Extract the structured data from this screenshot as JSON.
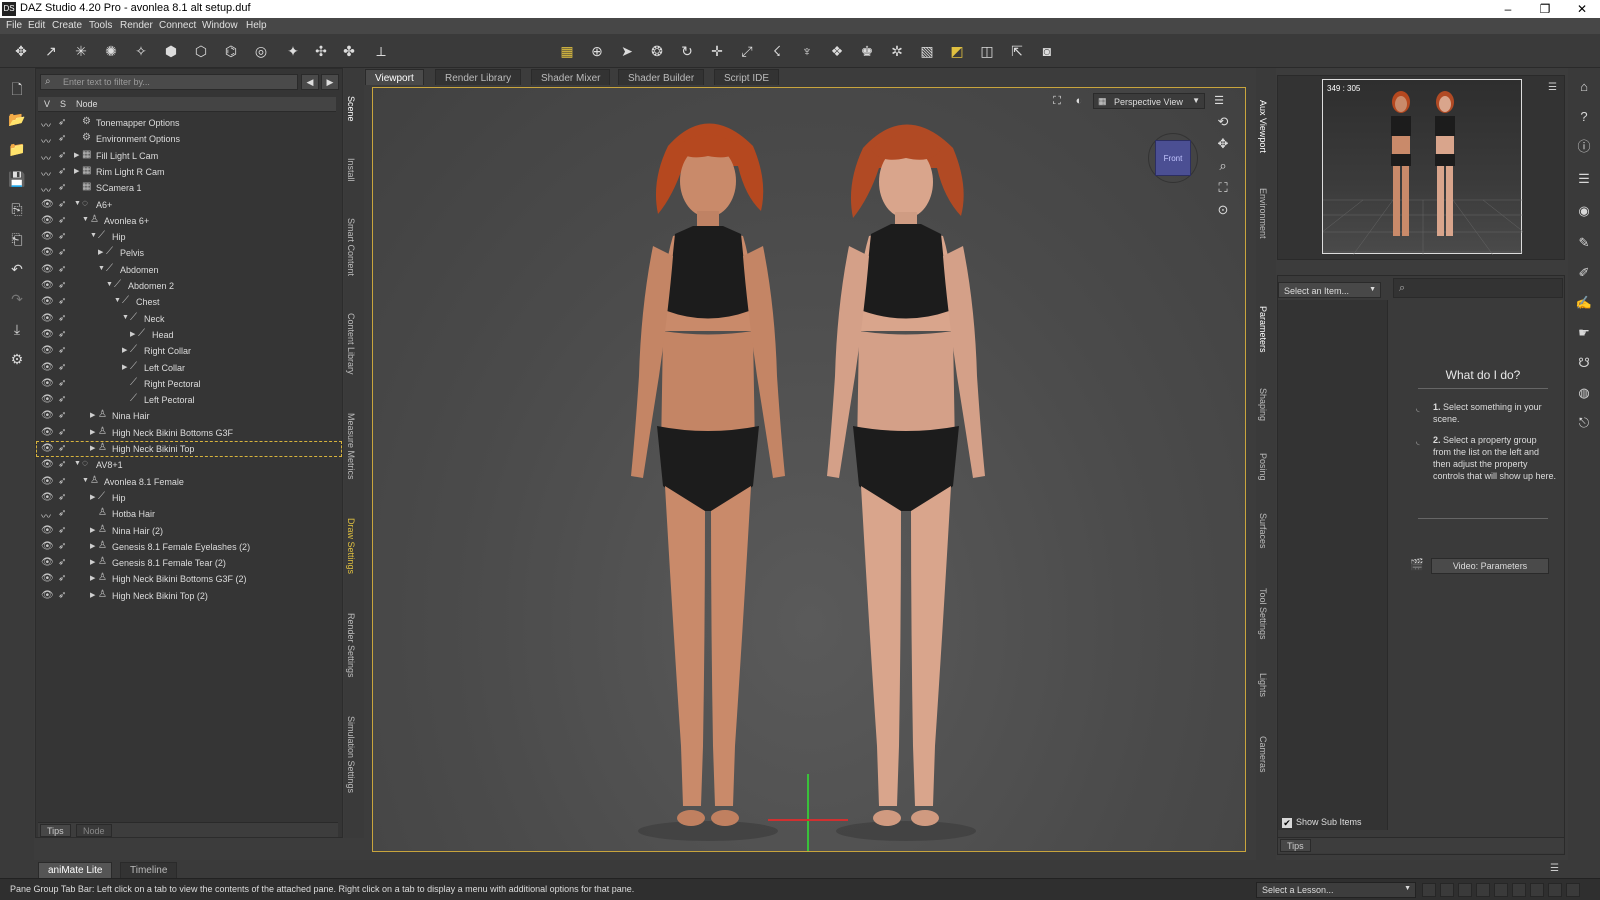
{
  "window": {
    "title": "DAZ Studio 4.20 Pro - avonlea 8.1 alt setup.duf",
    "logo": "DS",
    "controls": [
      "–",
      "❐",
      "✕"
    ]
  },
  "menu": [
    "File",
    "Edit",
    "Create",
    "Tools",
    "Render",
    "Connect",
    "Window",
    "Help"
  ],
  "scene": {
    "filter_placeholder": "Enter text to filter by...",
    "columns": {
      "v": "V",
      "s": "S",
      "node": "Node"
    },
    "rows": [
      {
        "label": "Tonemapper Options",
        "level": 0,
        "exp": "",
        "icon": "⚙",
        "vis": "closed"
      },
      {
        "label": "Environment Options",
        "level": 0,
        "exp": "",
        "icon": "⚙",
        "vis": "closed"
      },
      {
        "label": "Fill Light L Cam",
        "level": 0,
        "exp": "▶",
        "icon": "▦",
        "vis": "closed"
      },
      {
        "label": "Rim Light R Cam",
        "level": 0,
        "exp": "▶",
        "icon": "▦",
        "vis": "closed"
      },
      {
        "label": "SCamera 1",
        "level": 0,
        "exp": "",
        "icon": "▦",
        "vis": "closed"
      },
      {
        "label": "A6+",
        "level": 0,
        "exp": "▼",
        "icon": "◌",
        "vis": "open"
      },
      {
        "label": "Avonlea 6+",
        "level": 1,
        "exp": "▼",
        "icon": "♙",
        "vis": "open"
      },
      {
        "label": "Hip",
        "level": 2,
        "exp": "▼",
        "icon": "⟋",
        "vis": "open"
      },
      {
        "label": "Pelvis",
        "level": 3,
        "exp": "▶",
        "icon": "⟋",
        "vis": "open"
      },
      {
        "label": "Abdomen",
        "level": 3,
        "exp": "▼",
        "icon": "⟋",
        "vis": "open"
      },
      {
        "label": "Abdomen 2",
        "level": 4,
        "exp": "▼",
        "icon": "⟋",
        "vis": "open"
      },
      {
        "label": "Chest",
        "level": 5,
        "exp": "▼",
        "icon": "⟋",
        "vis": "open"
      },
      {
        "label": "Neck",
        "level": 6,
        "exp": "▼",
        "icon": "⟋",
        "vis": "open"
      },
      {
        "label": "Head",
        "level": 7,
        "exp": "▶",
        "icon": "⟋",
        "vis": "open"
      },
      {
        "label": "Right Collar",
        "level": 6,
        "exp": "▶",
        "icon": "⟋",
        "vis": "open"
      },
      {
        "label": "Left Collar",
        "level": 6,
        "exp": "▶",
        "icon": "⟋",
        "vis": "open"
      },
      {
        "label": "Right Pectoral",
        "level": 6,
        "exp": "",
        "icon": "⟋",
        "vis": "open"
      },
      {
        "label": "Left Pectoral",
        "level": 6,
        "exp": "",
        "icon": "⟋",
        "vis": "open"
      },
      {
        "label": "Nina Hair",
        "level": 2,
        "exp": "▶",
        "icon": "♙",
        "vis": "open"
      },
      {
        "label": "High Neck Bikini Bottoms G3F",
        "level": 2,
        "exp": "▶",
        "icon": "♙",
        "vis": "open"
      },
      {
        "label": "High Neck Bikini Top",
        "level": 2,
        "exp": "▶",
        "icon": "♙",
        "vis": "open",
        "highlight": true
      },
      {
        "label": "AV8+1",
        "level": 0,
        "exp": "▼",
        "icon": "◌",
        "vis": "open"
      },
      {
        "label": "Avonlea 8.1 Female",
        "level": 1,
        "exp": "▼",
        "icon": "♙",
        "vis": "open"
      },
      {
        "label": "Hip",
        "level": 2,
        "exp": "▶",
        "icon": "⟋",
        "vis": "open"
      },
      {
        "label": "Hotba Hair",
        "level": 2,
        "exp": "",
        "icon": "♙",
        "vis": "closed"
      },
      {
        "label": "Nina Hair (2)",
        "level": 2,
        "exp": "▶",
        "icon": "♙",
        "vis": "open"
      },
      {
        "label": "Genesis 8.1 Female Eyelashes (2)",
        "level": 2,
        "exp": "▶",
        "icon": "♙",
        "vis": "open"
      },
      {
        "label": "Genesis 8.1 Female Tear (2)",
        "level": 2,
        "exp": "▶",
        "icon": "♙",
        "vis": "open"
      },
      {
        "label": "High Neck Bikini Bottoms G3F (2)",
        "level": 2,
        "exp": "▶",
        "icon": "♙",
        "vis": "open"
      },
      {
        "label": "High Neck Bikini Top (2)",
        "level": 2,
        "exp": "▶",
        "icon": "♙",
        "vis": "open"
      }
    ],
    "footer_tabs": [
      "Tips",
      "Node"
    ]
  },
  "left_vtabs": [
    "Scene",
    "Install",
    "Smart Content",
    "Content Library",
    "Measure Metrics",
    "Draw Settings",
    "Render Settings",
    "Simulation Settings"
  ],
  "viewport_tabs": [
    "Viewport",
    "Render Library",
    "Shader Mixer",
    "Shader Builder",
    "Script IDE"
  ],
  "viewport": {
    "view_label": "Perspective View",
    "cube_label": "Front"
  },
  "right_vtabs_top": [
    "Aux Viewport",
    "Environment"
  ],
  "right_vtabs_bottom": [
    "Parameters",
    "Shaping",
    "Posing",
    "Surfaces",
    "Tool Settings",
    "Lights",
    "Cameras"
  ],
  "aux": {
    "size_label": "349 : 305"
  },
  "params": {
    "select_item": "Select an Item...",
    "help_title": "What do I do?",
    "step1_num": "1.",
    "step1_text": "Select something in your scene.",
    "step2_num": "2.",
    "step2_text": "Select a property group from the list on the left and then adjust the property controls that will show up here.",
    "video_button": "Video: Parameters",
    "show_sub": "Show Sub Items",
    "footer_tab": "Tips"
  },
  "bottom_tabs": [
    "aniMate Lite",
    "Timeline"
  ],
  "status": {
    "text": "Pane Group Tab Bar: Left click on a tab to view the contents of the attached pane. Right click on a tab to display a menu with additional options for that pane.",
    "lesson": "Select a Lesson..."
  },
  "colors": {
    "accent": "#c9a53d",
    "cube": "#4b4f93",
    "hair": "#b5481f",
    "bikini": "#1c1c1c",
    "skin1": "#c98a6a",
    "skin2": "#d9a58c"
  }
}
